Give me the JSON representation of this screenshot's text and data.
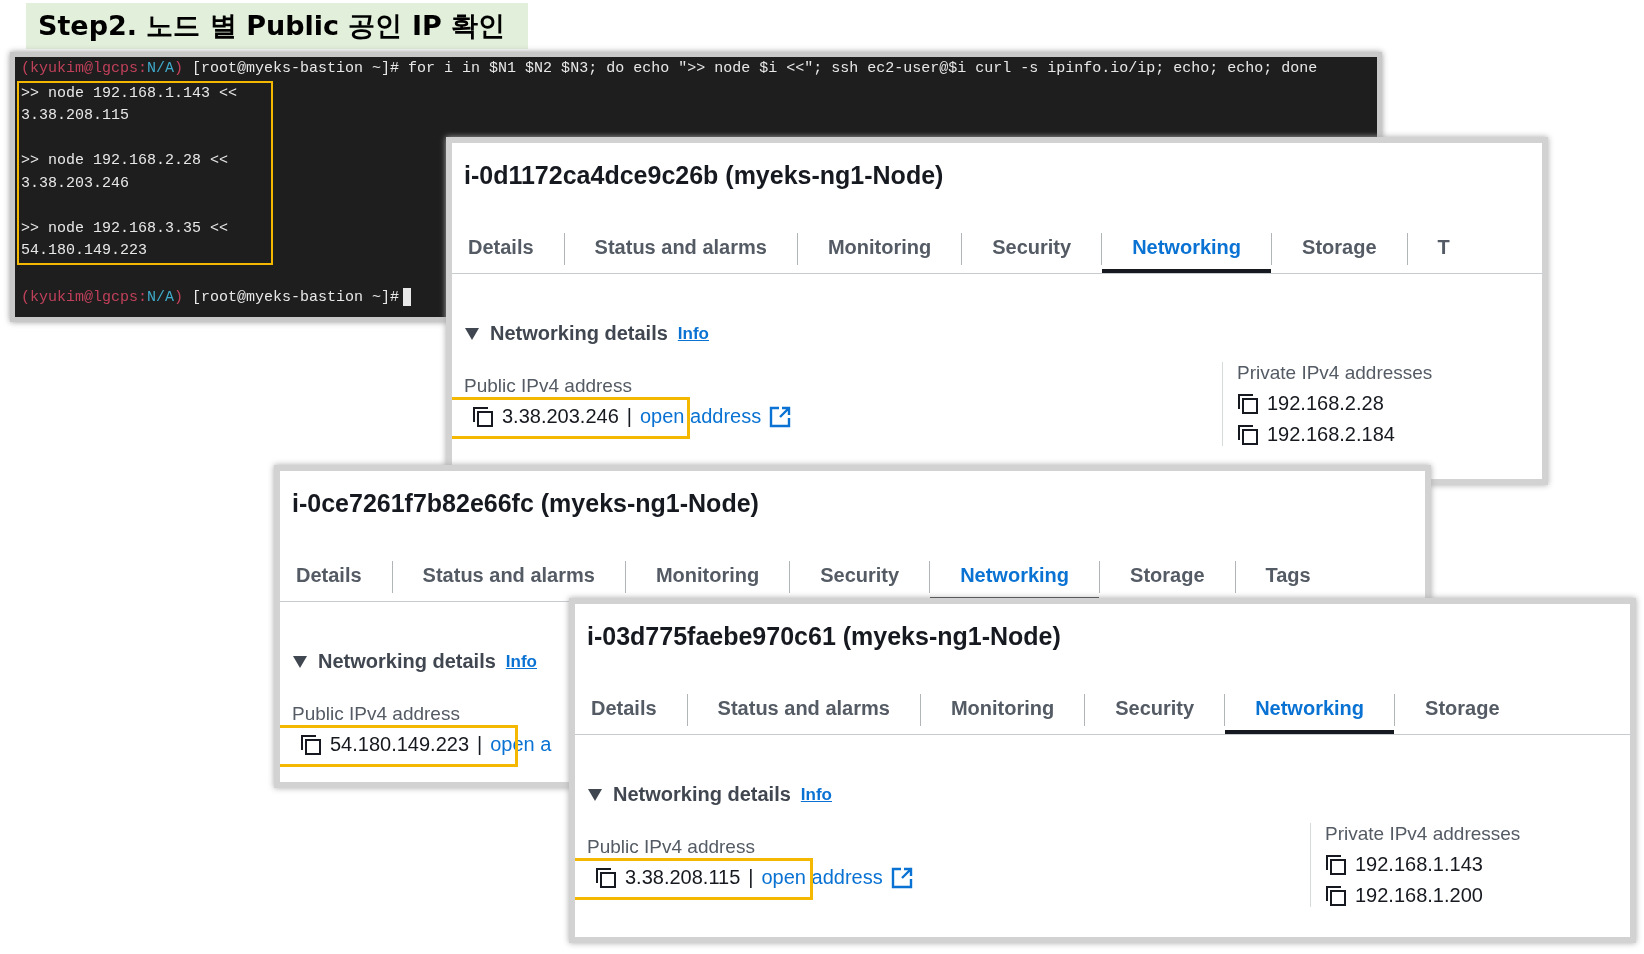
{
  "heading": "Step2. 노드 별 Public 공인 IP 확인",
  "terminal": {
    "command_line": {
      "user": "(kyukim@lgcps:",
      "context": "N/A",
      "close": ")",
      "command": "[root@myeks-bastion ~]# for i in $N1 $N2 $N3; do echo \">> node $i <<\"; ssh ec2-user@$i curl -s ipinfo.io/ip; echo; echo; done"
    },
    "output": {
      "highlighted": true,
      "lines": [
        {
          "kind": "output",
          "text": ">> node 192.168.1.143 <<"
        },
        {
          "kind": "output",
          "text": "3.38.208.115"
        },
        {
          "kind": "blank"
        },
        {
          "kind": "output",
          "text": ">> node 192.168.2.28 <<"
        },
        {
          "kind": "output",
          "text": "3.38.203.246"
        },
        {
          "kind": "blank"
        },
        {
          "kind": "output",
          "text": ">> node 192.168.3.35 <<"
        },
        {
          "kind": "output",
          "text": "54.180.149.223"
        }
      ]
    },
    "prompt": {
      "user": "(kyukim@lgcps:",
      "context": "N/A",
      "close": ")",
      "command": "[root@myeks-bastion ~]#",
      "cursor": true
    }
  },
  "panels": [
    {
      "title": "i-0d1172ca4dce9c26b (myeks-ng1-Node)",
      "tabs": [
        {
          "label": "Details",
          "selected": false
        },
        {
          "label": "Status and alarms",
          "selected": false
        },
        {
          "label": "Monitoring",
          "selected": false
        },
        {
          "label": "Security",
          "selected": false
        },
        {
          "label": "Networking",
          "selected": true
        },
        {
          "label": "Storage",
          "selected": false
        },
        {
          "label": "T",
          "selected": false
        }
      ],
      "section": {
        "title": "Networking details",
        "info": "Info",
        "expanded": true
      },
      "public": {
        "label": "Public IPv4 address",
        "address": "3.38.203.246",
        "separator": "|",
        "link": "open address",
        "external": true,
        "highlighted": true
      },
      "private": {
        "label": "Private IPv4 addresses",
        "addresses": [
          "192.168.2.28",
          "192.168.2.184"
        ]
      }
    },
    {
      "title": "i-0ce7261f7b82e66fc (myeks-ng1-Node)",
      "tabs": [
        {
          "label": "Details",
          "selected": false
        },
        {
          "label": "Status and alarms",
          "selected": false
        },
        {
          "label": "Monitoring",
          "selected": false
        },
        {
          "label": "Security",
          "selected": false
        },
        {
          "label": "Networking",
          "selected": true
        },
        {
          "label": "Storage",
          "selected": false
        },
        {
          "label": "Tags",
          "selected": false
        }
      ],
      "section": {
        "title": "Networking details",
        "info": "Info",
        "expanded": true
      },
      "public": {
        "label": "Public IPv4 address",
        "address": "54.180.149.223",
        "separator": "|",
        "link": "open a",
        "highlighted": true
      }
    },
    {
      "title": "i-03d775faebe970c61 (myeks-ng1-Node)",
      "tabs": [
        {
          "label": "Details",
          "selected": false
        },
        {
          "label": "Status and alarms",
          "selected": false
        },
        {
          "label": "Monitoring",
          "selected": false
        },
        {
          "label": "Security",
          "selected": false
        },
        {
          "label": "Networking",
          "selected": true
        },
        {
          "label": "Storage",
          "selected": false
        }
      ],
      "section": {
        "title": "Networking details",
        "info": "Info",
        "expanded": true
      },
      "public": {
        "label": "Public IPv4 address",
        "address": "3.38.208.115",
        "separator": "|",
        "link": "open address",
        "external": true,
        "highlighted": true
      },
      "private": {
        "label": "Private IPv4 addresses",
        "addresses": [
          "192.168.1.143",
          "192.168.1.200"
        ]
      }
    }
  ]
}
